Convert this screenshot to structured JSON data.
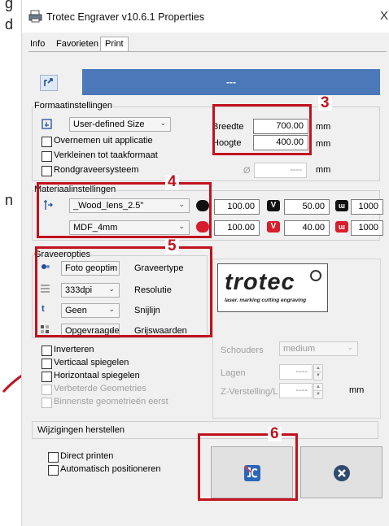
{
  "page_fragment": {
    "char_top": "g",
    "char_d": "d",
    "char_n": "n"
  },
  "window": {
    "title": "Trotec Engraver v10.6.1 Properties",
    "close_glyph": "X"
  },
  "tabs": [
    {
      "label": "Info"
    },
    {
      "label": "Favorieten"
    },
    {
      "label": "Print"
    }
  ],
  "job": {
    "name": "---"
  },
  "format": {
    "legend": "Formaatinstellingen",
    "size_value": "User-defined Size",
    "width_label": "Breedte",
    "width_value": "700.00",
    "width_unit": "mm",
    "height_label": "Hoogte",
    "height_value": "400.00",
    "height_unit": "mm",
    "cb_overnemen": "Overnemen uit applicatie",
    "cb_verkleinen": "Verkleinen tot taakformaat",
    "cb_rond": "Rondgraveersysteem",
    "diameter_symbol": "Ø",
    "diameter_value": "----",
    "diameter_unit": "mm"
  },
  "material": {
    "legend": "Materiaalinstellingen",
    "material_value": "_Wood_lens_2.5\"",
    "sub_value": "MDF_4mm",
    "row1": {
      "p": "100.00",
      "v": "50.00",
      "w": "1000"
    },
    "row2": {
      "p": "100.00",
      "v": "40.00",
      "w": "1000"
    },
    "badge_v": "V"
  },
  "engrave": {
    "legend": "Graveeropties",
    "type_value": "Foto geoptim",
    "type_label": "Graveertype",
    "res_value": "333dpi",
    "res_label": "Resolutie",
    "cut_value": "Geen",
    "cut_label": "Snijlijn",
    "gray_value": "Opgevraagde",
    "gray_label": "Grijswaarden",
    "icon_t": "t"
  },
  "options": {
    "invert": "Inverteren",
    "vflip": "Verticaal spiegelen",
    "hflip": "Horizontaal spiegelen",
    "improved": "Verbeterde Geometries",
    "inner": "Binnenste geometrieën eerst"
  },
  "logo": {
    "brand": "trotec",
    "tagline": "laser. marking cutting engraving"
  },
  "right_settings": {
    "shoulders_label": "Schouders",
    "shoulders_value": "medium",
    "layers_label": "Lagen",
    "layers_value": "----",
    "z_label": "Z-Verstelling/L",
    "z_value": "----",
    "z_unit": "mm"
  },
  "footer": {
    "reset_label": "Wijzigingen herstellen",
    "direct_print": "Direct printen",
    "auto_position": "Automatisch positioneren"
  },
  "annotations": {
    "n3": "3",
    "n4": "4",
    "n5": "5",
    "n6": "6",
    "color": "#c1121f"
  }
}
